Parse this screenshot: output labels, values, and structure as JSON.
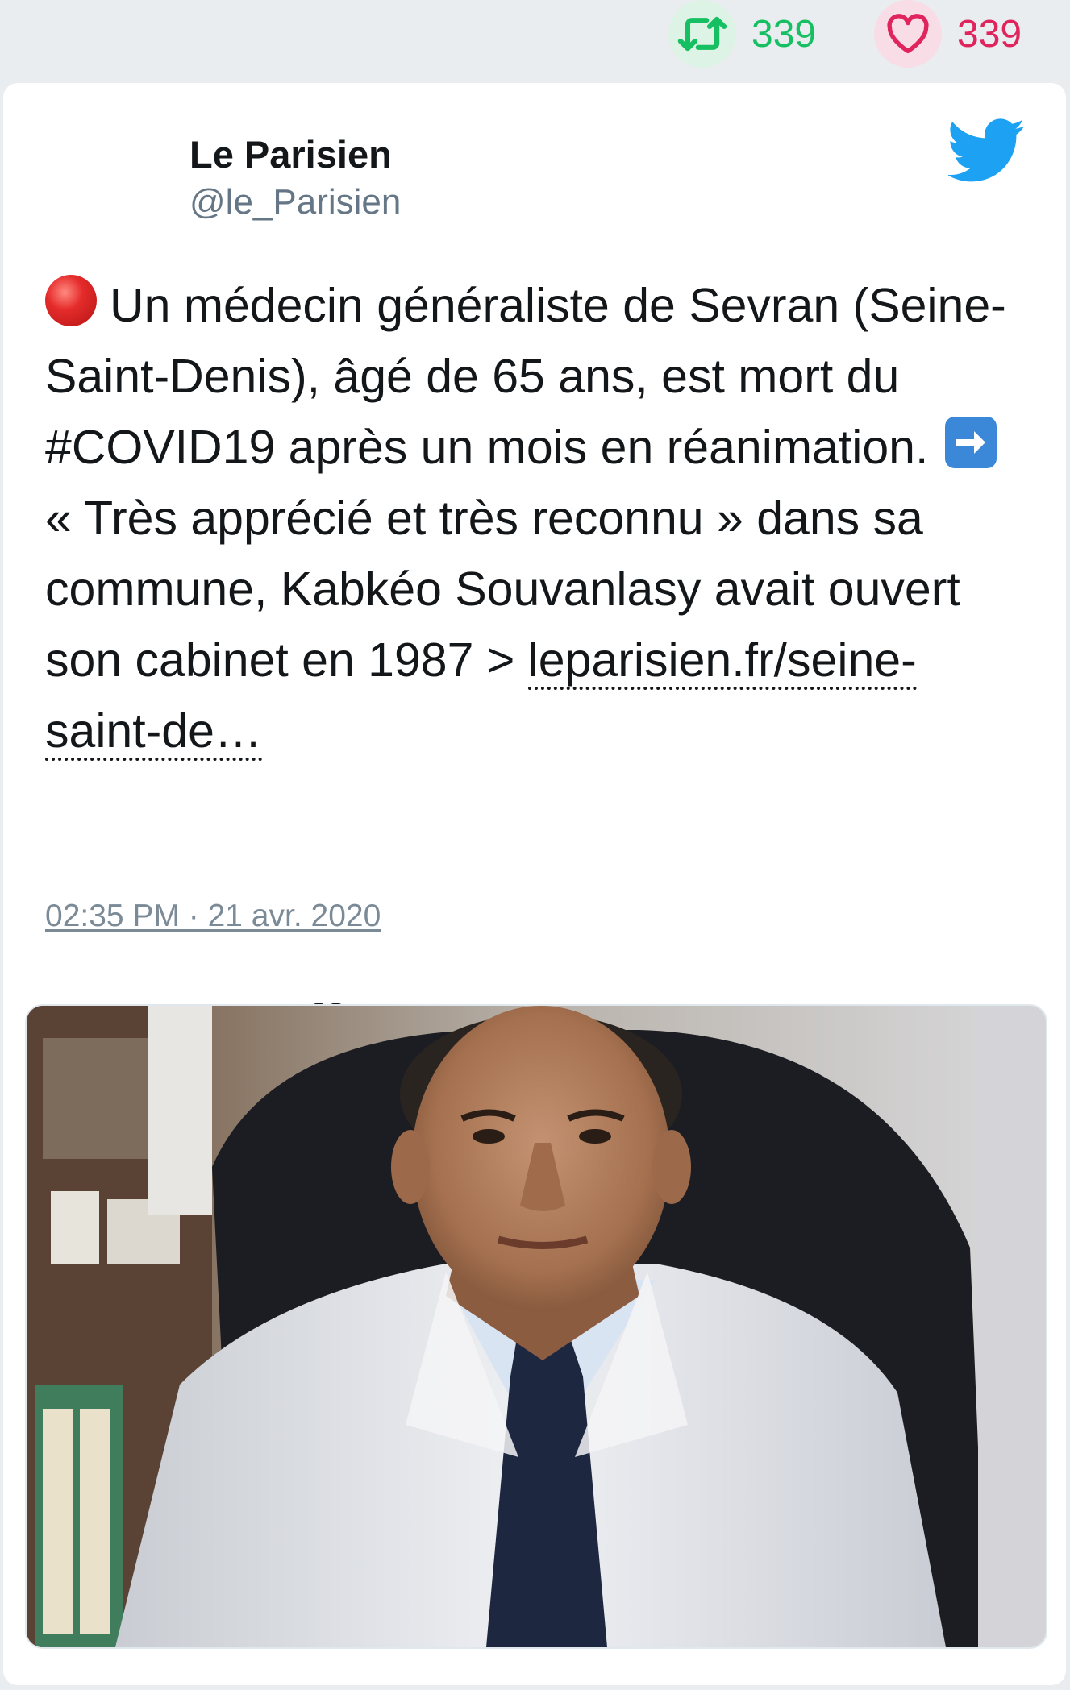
{
  "stats": {
    "retweets": "339",
    "likes": "339",
    "retweet_color": "#17bf63",
    "like_color": "#e0245e"
  },
  "author": {
    "name": "Le Parisien",
    "handle": "@le_Parisien"
  },
  "icons": {
    "brand": "twitter-bird-icon",
    "retweet": "retweet-icon",
    "like": "heart-icon",
    "reply": "reply-icon"
  },
  "tweet": {
    "text_1": "Un médecin généraliste de Sevran (Seine-Saint-Denis), âgé de 65 ans, est mort du #COVID19 après un mois en réanimation.",
    "text_2": "« Très apprécié et très reconnu » dans sa commune, Kabkéo Souvanlasy avait ouvert son cabinet en 1987 >",
    "link": "leparisien.fr/seine-saint-de…",
    "timestamp": "02:35 PM · 21 avr. 2020"
  },
  "colors": {
    "brand_blue": "#1da1f2",
    "text": "#14171a",
    "secondary": "#657786"
  }
}
